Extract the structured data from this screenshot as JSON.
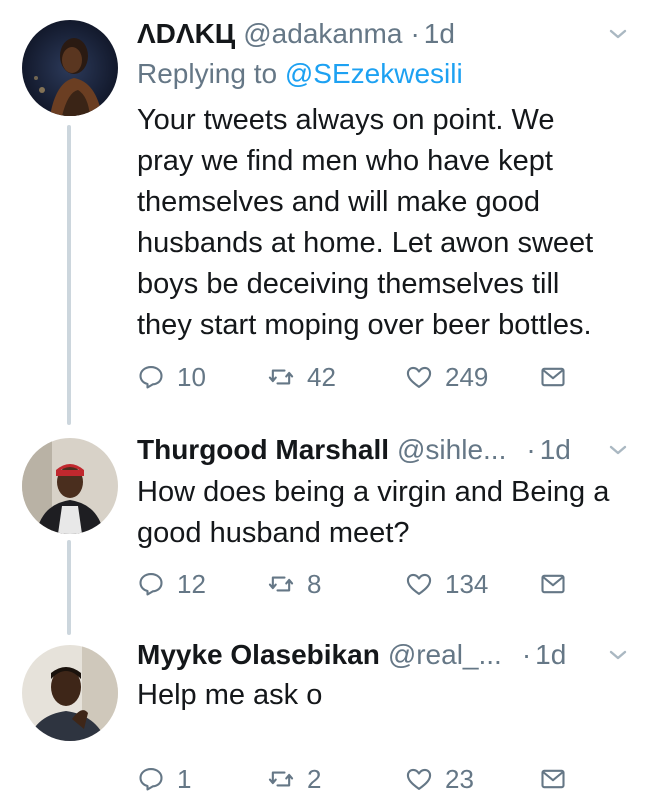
{
  "tweets": [
    {
      "name": "ΛDΛKЦ",
      "handle": "@adakanma",
      "time": "1d",
      "replying_prefix": "Replying to",
      "replying_to": "@SEzekwesili",
      "text_lines": [
        "Your tweets always on point. We",
        "pray we find men who have kept",
        "themselves and will make good",
        "husbands at home. Let awon sweet",
        "boys be deceiving themselves till",
        "they start moping over beer bottles."
      ],
      "replies": "10",
      "retweets": "42",
      "likes": "249"
    },
    {
      "name": "Thurgood Marshall",
      "handle": "@sihle...",
      "time": "1d",
      "text_lines": [
        "How does being a virgin and Being a",
        "good husband meet?"
      ],
      "replies": "12",
      "retweets": "8",
      "likes": "134"
    },
    {
      "name": "Myyke Olasebikan",
      "handle": "@real_...",
      "time": "1d",
      "text_lines": [
        "Help me ask o"
      ],
      "replies": "1",
      "retweets": "2",
      "likes": "23"
    }
  ],
  "separator": "·",
  "icons": {
    "reply": "reply-icon",
    "retweet": "retweet-icon",
    "like": "heart-icon",
    "dm": "envelope-icon",
    "menu": "chevron-down-icon"
  },
  "colors": {
    "text": "#14171a",
    "secondary": "#657786",
    "link": "#1da1f2",
    "thread_line": "#ccd6dd"
  }
}
